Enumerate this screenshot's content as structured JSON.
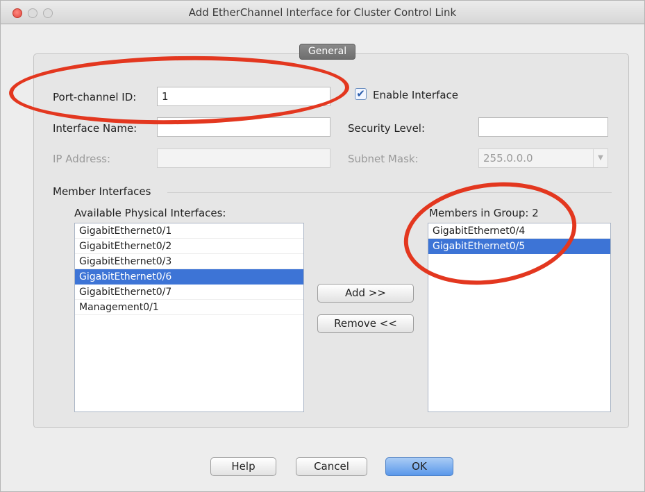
{
  "window": {
    "title": "Add EtherChannel Interface for Cluster Control Link"
  },
  "tabs": {
    "general": "General"
  },
  "fields": {
    "port_channel_id_label": "Port-channel ID:",
    "port_channel_id_value": "1",
    "enable_interface_label": "Enable Interface",
    "enable_interface_checked": true,
    "interface_name_label": "Interface Name:",
    "interface_name_value": "",
    "security_level_label": "Security Level:",
    "security_level_value": "",
    "ip_address_label": "IP Address:",
    "ip_address_value": "",
    "subnet_mask_label": "Subnet Mask:",
    "subnet_mask_value": "255.0.0.0"
  },
  "members": {
    "section_label": "Member Interfaces",
    "available_label": "Available Physical Interfaces:",
    "available": [
      {
        "label": "GigabitEthernet0/1",
        "selected": false
      },
      {
        "label": "GigabitEthernet0/2",
        "selected": false
      },
      {
        "label": "GigabitEthernet0/3",
        "selected": false
      },
      {
        "label": "GigabitEthernet0/6",
        "selected": true
      },
      {
        "label": "GigabitEthernet0/7",
        "selected": false
      },
      {
        "label": "Management0/1",
        "selected": false
      }
    ],
    "group_label": "Members in Group: 2",
    "group": [
      {
        "label": "GigabitEthernet0/4",
        "selected": false
      },
      {
        "label": "GigabitEthernet0/5",
        "selected": true
      }
    ],
    "add_label": "Add >>",
    "remove_label": "Remove <<"
  },
  "footer": {
    "help_label": "Help",
    "cancel_label": "Cancel",
    "ok_label": "OK"
  },
  "colors": {
    "annotation": "#e3371f",
    "selection": "#3d74d6"
  },
  "icons": {
    "check": "✔",
    "dropdown": "▼"
  }
}
